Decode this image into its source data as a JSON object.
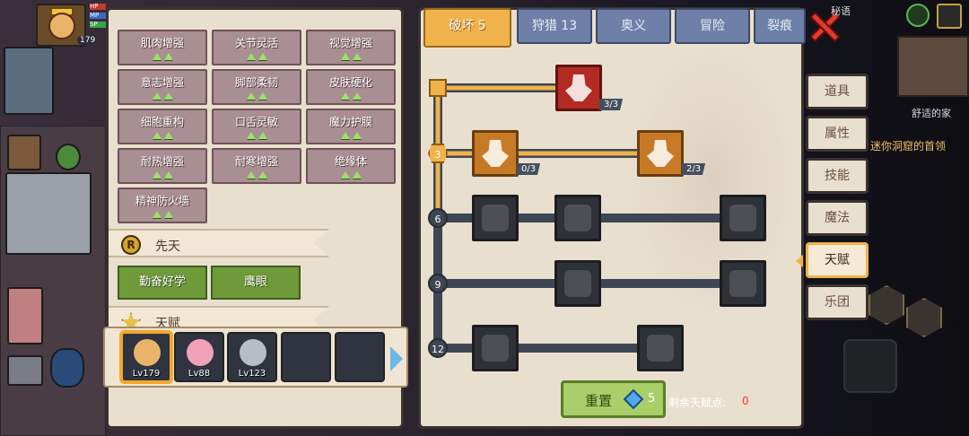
{
  "player": {
    "level": "179",
    "stats": [
      "HP",
      "MP",
      "SP"
    ]
  },
  "traits": [
    "肌肉增强",
    "关节灵活",
    "视觉增强",
    "意志增强",
    "脚部柔韧",
    "皮肤硬化",
    "细胞重构",
    "口舌灵敏",
    "魔力护膜",
    "耐热增强",
    "耐寒增强",
    "绝缘体",
    "精神防火墙"
  ],
  "sections": {
    "innate": {
      "label": "先天",
      "icon": "R",
      "items": [
        "勤奋好学",
        "鹰眼"
      ]
    },
    "talent": {
      "label": "天赋"
    }
  },
  "heroes": [
    {
      "level": "Lv179",
      "color": "#e9b36b"
    },
    {
      "level": "Lv88",
      "color": "#f0a0b8"
    },
    {
      "level": "Lv123",
      "color": "#b8bcc4"
    }
  ],
  "tabs": [
    {
      "label": "破坏 5",
      "active": true
    },
    {
      "label": "狩猎 13",
      "active": false
    },
    {
      "label": "奥义",
      "active": false
    },
    {
      "label": "冒险",
      "active": false
    },
    {
      "label": "裂痕",
      "active": false
    }
  ],
  "tree": {
    "tiers": [
      "3",
      "6",
      "9",
      "12"
    ],
    "nodes": [
      {
        "name": "arm-wrestle-node",
        "count": "3/3",
        "state": "red"
      },
      {
        "name": "body-node",
        "count": "0/3",
        "state": "active"
      },
      {
        "name": "arrow-node",
        "count": "2/3",
        "state": "active"
      },
      {
        "name": "cards-node",
        "state": "locked"
      },
      {
        "name": "fist-punch-node",
        "state": "locked"
      },
      {
        "name": "wand-node",
        "state": "locked"
      },
      {
        "name": "ripple-node",
        "state": "locked"
      },
      {
        "name": "beast-node",
        "state": "locked"
      },
      {
        "name": "raised-fist-node",
        "state": "locked"
      },
      {
        "name": "bandaged-fist-node",
        "state": "locked"
      }
    ]
  },
  "reset": {
    "label": "重置",
    "cost": "5"
  },
  "points": {
    "label": "剩余天赋点:",
    "value": "0"
  },
  "side_menu": [
    {
      "label": "道具",
      "active": false
    },
    {
      "label": "属性",
      "active": false
    },
    {
      "label": "技能",
      "active": false
    },
    {
      "label": "魔法",
      "active": false
    },
    {
      "label": "天赋",
      "active": true
    },
    {
      "label": "乐团",
      "active": false
    }
  ],
  "hud": {
    "home": "舒适的家",
    "quest": "迷你洞窟的首领",
    "top_text": "秘语"
  }
}
